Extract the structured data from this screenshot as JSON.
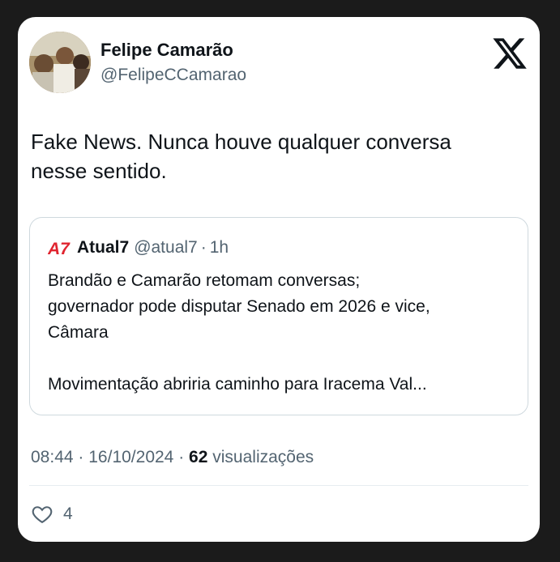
{
  "author": {
    "name": "Felipe Camarão",
    "handle": "@FelipeCCamarao"
  },
  "tweet": {
    "text_lines": [
      "Fake News. Nunca houve qualquer conversa",
      "nesse sentido."
    ]
  },
  "quoted": {
    "logo_text": "A7",
    "name": "Atual7",
    "handle": "@atual7",
    "separator": "·",
    "time": "1h",
    "lines": [
      "Brandão e Camarão retomam conversas;",
      "governador pode disputar Senado em 2026 e vice,",
      "Câmara",
      "Movimentação abriria caminho para Iracema Val..."
    ]
  },
  "meta": {
    "time": "08:44",
    "sep1": "·",
    "date": "16/10/2024",
    "sep2": "·",
    "views_count": "62",
    "views_label": "visualizações"
  },
  "actions": {
    "like_count": "4"
  },
  "colors": {
    "background": "#1b1b1b",
    "card": "#ffffff",
    "text": "#0f1419",
    "secondary": "#536471",
    "border": "#cfd9de",
    "atual7_red": "#e0242f"
  },
  "icons": {
    "brand": "x-logo-icon",
    "like": "heart-icon"
  }
}
